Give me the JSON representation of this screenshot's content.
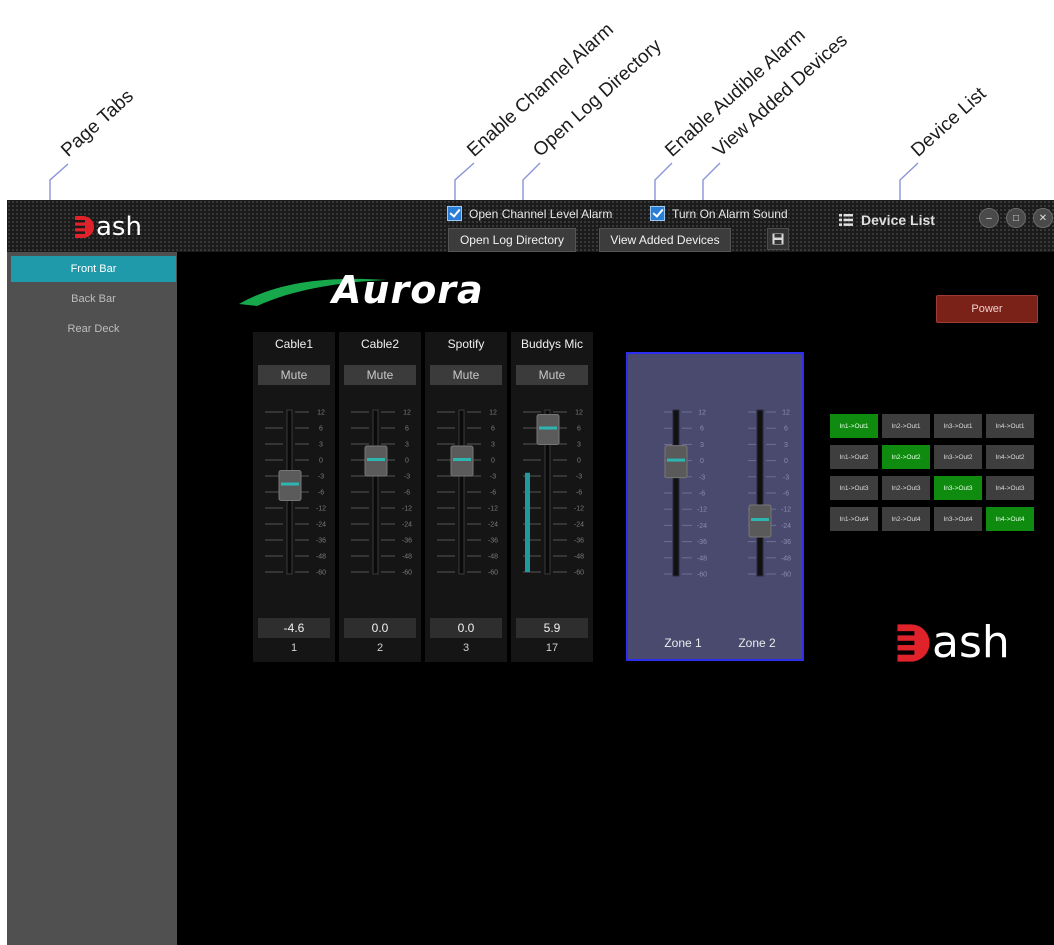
{
  "annotations": {
    "page_tabs": "Page Tabs",
    "enable_channel_alarm": "Enable Channel Alarm",
    "open_log_directory": "Open Log Directory",
    "enable_audible_alarm": "Enable Audible Alarm",
    "view_added_devices": "View Added Devices",
    "device_list": "Device List"
  },
  "app": {
    "logo_text": "ash",
    "checkboxes": {
      "channel_alarm": {
        "label": "Open Channel Level Alarm",
        "checked": true
      },
      "alarm_sound": {
        "label": "Turn On Alarm Sound",
        "checked": true
      }
    },
    "buttons": {
      "open_log": "Open Log Directory",
      "view_devices": "View Added Devices"
    },
    "device_list_label": "Device List"
  },
  "tabs": [
    {
      "label": "Front Bar",
      "active": true
    },
    {
      "label": "Back Bar",
      "active": false
    },
    {
      "label": "Rear Deck",
      "active": false
    }
  ],
  "main": {
    "brand_logo": "Aurora",
    "power_label": "Power",
    "scale_labels": [
      "12",
      "6",
      "3",
      "0",
      "-3",
      "-6",
      "-12",
      "-24",
      "-36",
      "-48",
      "-60"
    ],
    "channels": [
      {
        "name": "Cable1",
        "mute": "Mute",
        "value": "-4.6",
        "number": "1",
        "level_pct": 0
      },
      {
        "name": "Cable2",
        "mute": "Mute",
        "value": "0.0",
        "number": "2",
        "level_pct": 0
      },
      {
        "name": "Spotify",
        "mute": "Mute",
        "value": "0.0",
        "number": "3",
        "level_pct": 0
      },
      {
        "name": "Buddys Mic",
        "mute": "Mute",
        "value": "5.9",
        "number": "17",
        "level_pct": 62
      }
    ],
    "zones": [
      {
        "name": "Zone 1"
      },
      {
        "name": "Zone 2"
      }
    ],
    "routing": [
      [
        {
          "label": "In1->Out1",
          "on": true
        },
        {
          "label": "In2->Out1",
          "on": false
        },
        {
          "label": "In3->Out1",
          "on": false
        },
        {
          "label": "In4->Out1",
          "on": false
        }
      ],
      [
        {
          "label": "In1->Out2",
          "on": false
        },
        {
          "label": "In2->Out2",
          "on": true
        },
        {
          "label": "In3->Out2",
          "on": false
        },
        {
          "label": "In4->Out2",
          "on": false
        }
      ],
      [
        {
          "label": "In1->Out3",
          "on": false
        },
        {
          "label": "In2->Out3",
          "on": false
        },
        {
          "label": "In3->Out3",
          "on": true
        },
        {
          "label": "In4->Out3",
          "on": false
        }
      ],
      [
        {
          "label": "In1->Out4",
          "on": false
        },
        {
          "label": "In2->Out4",
          "on": false
        },
        {
          "label": "In3->Out4",
          "on": false
        },
        {
          "label": "In4->Out4",
          "on": true
        }
      ]
    ],
    "dash_logo_text": "ash"
  },
  "colors": {
    "accent_tab": "#1f9aab",
    "route_on": "#0f8c0f",
    "zone_panel": "#4a4a6e",
    "zone_border": "#2d2df0",
    "power": "#7a2118",
    "dash_red": "#e0222a"
  }
}
